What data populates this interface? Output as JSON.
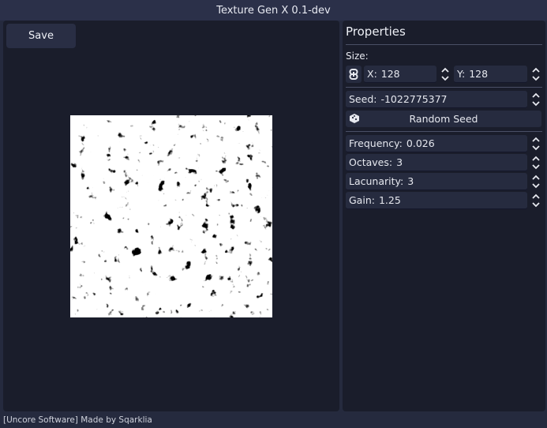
{
  "window": {
    "title": "Texture Gen X 0.1-dev"
  },
  "toolbar": {
    "save_label": "Save"
  },
  "properties": {
    "title": "Properties",
    "size_label": "Size:",
    "size_x": {
      "label": "X:",
      "value": "128"
    },
    "size_y": {
      "label": "Y:",
      "value": "128"
    },
    "seed": {
      "label": "Seed:",
      "value": "-1022775377"
    },
    "random_seed_label": "Random Seed",
    "frequency": {
      "label": "Frequency:",
      "value": "0.026"
    },
    "octaves": {
      "label": "Octaves:",
      "value": "3"
    },
    "lacunarity": {
      "label": "Lacunarity:",
      "value": "3"
    },
    "gain": {
      "label": "Gain:",
      "value": "1.25"
    }
  },
  "footer": {
    "text": "[Uncore Software] Made by Sqarklia"
  },
  "colors": {
    "background": "#252a3e",
    "panel": "#1a1d2b",
    "field": "#262b3f",
    "text": "#e6e8ef"
  },
  "icons": [
    "link-icon",
    "spinner-arrows-icon",
    "dice-icon"
  ]
}
